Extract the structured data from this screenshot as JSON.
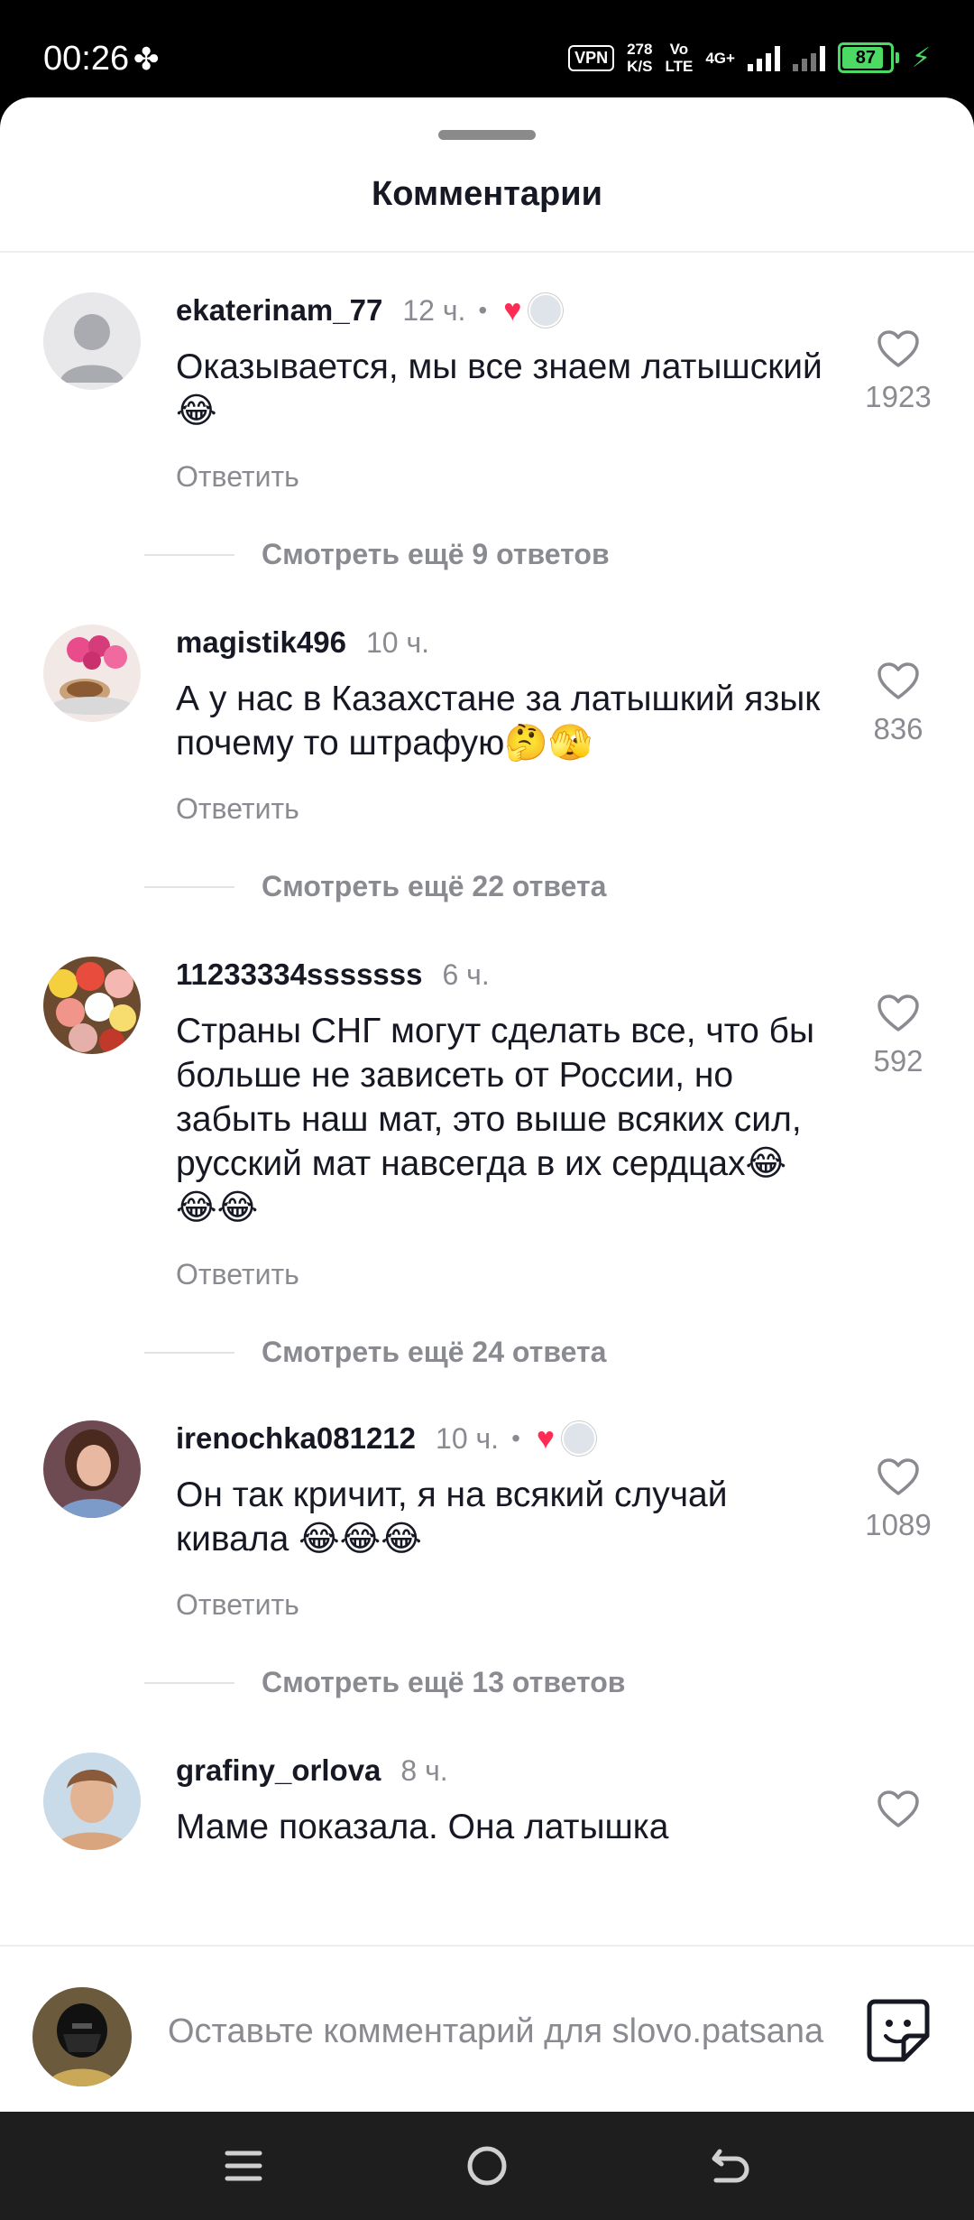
{
  "status": {
    "time": "00:26",
    "vpn": "VPN",
    "speed_value": "278",
    "speed_unit": "K/S",
    "net1_top": "Vo",
    "net1_bottom": "LTE",
    "net2": "4G+",
    "battery": "87"
  },
  "sheet": {
    "title": "Комментарии"
  },
  "comments": [
    {
      "username": "ekaterinam_77",
      "time": "12 ч.",
      "dot": "•",
      "creator_liked": true,
      "text": "Оказывается,  мы все знаем латышский😂",
      "reply_label": "Ответить",
      "likes": "1923",
      "more_replies": "Смотреть ещё 9 ответов"
    },
    {
      "username": "magistik496",
      "time": "10 ч.",
      "text": "А у нас в Казахстане за латышкий язык почему то штрафую🤔🫣",
      "reply_label": "Ответить",
      "likes": "836",
      "more_replies": "Смотреть ещё 22 ответа"
    },
    {
      "username": "11233334sssssss",
      "time": "6 ч.",
      "text": "Страны СНГ могут сделать все, что бы больше не зависеть от России, но забыть наш мат, это выше всяких сил, русский мат навсегда в их сердцах😂😂😂",
      "reply_label": "Ответить",
      "likes": "592",
      "more_replies": "Смотреть ещё 24 ответа"
    },
    {
      "username": "irenochka081212",
      "time": "10 ч.",
      "dot": "•",
      "creator_liked": true,
      "text": "Он так кричит, я на всякий случай кивала 😂😂😂",
      "reply_label": "Ответить",
      "likes": "1089",
      "more_replies": "Смотреть ещё 13 ответов"
    },
    {
      "username": "grafiny_orlova",
      "time": "8 ч.",
      "text": "Маме показала. Она латышка"
    }
  ],
  "quick_emojis": [
    "🤣",
    "👍",
    "🔥",
    "👏",
    "😢",
    "😍",
    "😮",
    "😂"
  ],
  "composer": {
    "placeholder": "Оставьте комментарий для slovo.patsana"
  }
}
